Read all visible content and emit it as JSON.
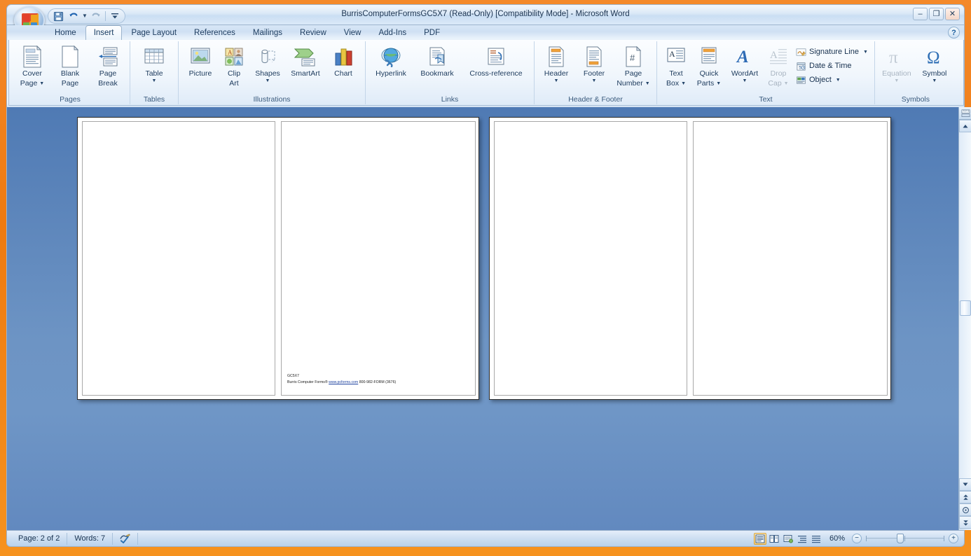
{
  "window": {
    "title": "BurrisComputerFormsGC5X7 (Read-Only) [Compatibility Mode] - Microsoft Word",
    "minimize_label": "–",
    "restore_label": "❐",
    "close_label": "✕",
    "help_label": "?",
    "accent_orange": "#f6921e",
    "workspace_blue": "#6289bf"
  },
  "quick_access": {
    "items": [
      {
        "name": "save",
        "label": "Save"
      },
      {
        "name": "undo",
        "label": "Undo"
      },
      {
        "name": "redo",
        "label": "Redo"
      }
    ],
    "customize_label": "Customize Quick Access Toolbar"
  },
  "ribbon": {
    "tabs": [
      {
        "label": "Home",
        "active": false
      },
      {
        "label": "Insert",
        "active": true
      },
      {
        "label": "Page Layout",
        "active": false
      },
      {
        "label": "References",
        "active": false
      },
      {
        "label": "Mailings",
        "active": false
      },
      {
        "label": "Review",
        "active": false
      },
      {
        "label": "View",
        "active": false
      },
      {
        "label": "Add-Ins",
        "active": false
      },
      {
        "label": "PDF",
        "active": false
      }
    ],
    "groups": [
      {
        "name": "pages",
        "label": "Pages",
        "buttons": [
          {
            "label_line1": "Cover",
            "label_line2": "Page",
            "dropdown": true,
            "disabled": false
          },
          {
            "label_line1": "Blank",
            "label_line2": "Page",
            "dropdown": false,
            "disabled": false
          },
          {
            "label_line1": "Page",
            "label_line2": "Break",
            "dropdown": false,
            "disabled": false
          }
        ]
      },
      {
        "name": "tables",
        "label": "Tables",
        "buttons": [
          {
            "label_line1": "Table",
            "label_line2": "",
            "dropdown": true,
            "disabled": false
          }
        ]
      },
      {
        "name": "illustrations",
        "label": "Illustrations",
        "buttons": [
          {
            "label_line1": "Picture",
            "label_line2": "",
            "dropdown": false,
            "disabled": false
          },
          {
            "label_line1": "Clip",
            "label_line2": "Art",
            "dropdown": false,
            "disabled": false
          },
          {
            "label_line1": "Shapes",
            "label_line2": "",
            "dropdown": true,
            "disabled": false
          },
          {
            "label_line1": "SmartArt",
            "label_line2": "",
            "dropdown": false,
            "disabled": false
          },
          {
            "label_line1": "Chart",
            "label_line2": "",
            "dropdown": false,
            "disabled": false
          }
        ]
      },
      {
        "name": "links",
        "label": "Links",
        "buttons": [
          {
            "label_line1": "Hyperlink",
            "label_line2": "",
            "dropdown": false,
            "disabled": false
          },
          {
            "label_line1": "Bookmark",
            "label_line2": "",
            "dropdown": false,
            "disabled": false
          },
          {
            "label_line1": "Cross-reference",
            "label_line2": "",
            "dropdown": false,
            "disabled": false
          }
        ]
      },
      {
        "name": "header-footer",
        "label": "Header & Footer",
        "buttons": [
          {
            "label_line1": "Header",
            "label_line2": "",
            "dropdown": true,
            "disabled": false
          },
          {
            "label_line1": "Footer",
            "label_line2": "",
            "dropdown": true,
            "disabled": false
          },
          {
            "label_line1": "Page",
            "label_line2": "Number",
            "dropdown": true,
            "disabled": false
          }
        ]
      },
      {
        "name": "text",
        "label": "Text",
        "buttons": [
          {
            "label_line1": "Text",
            "label_line2": "Box",
            "dropdown": true,
            "disabled": false
          },
          {
            "label_line1": "Quick",
            "label_line2": "Parts",
            "dropdown": true,
            "disabled": false
          },
          {
            "label_line1": "WordArt",
            "label_line2": "",
            "dropdown": true,
            "disabled": false
          },
          {
            "label_line1": "Drop",
            "label_line2": "Cap",
            "dropdown": true,
            "disabled": true
          }
        ],
        "small_buttons": [
          {
            "label": "Signature Line",
            "dropdown": true
          },
          {
            "label": "Date & Time",
            "dropdown": false
          },
          {
            "label": "Object",
            "dropdown": true
          }
        ]
      },
      {
        "name": "symbols",
        "label": "Symbols",
        "buttons": [
          {
            "label_line1": "Equation",
            "label_line2": "",
            "dropdown": true,
            "disabled": true
          },
          {
            "label_line1": "Symbol",
            "label_line2": "",
            "dropdown": true,
            "disabled": false
          }
        ]
      }
    ]
  },
  "document": {
    "spreads": [
      {
        "name": "spread-1",
        "pages": [
          {
            "name": "page-1",
            "text_lines": []
          },
          {
            "name": "page-2",
            "text_lines": [
              {
                "text": "GC5X7",
                "link": ""
              },
              {
                "prefix": "Burris Computer Forms® ",
                "link": "www.pcforms.com",
                "suffix": " 800-982-FORM (3676)"
              }
            ]
          }
        ]
      },
      {
        "name": "spread-2",
        "pages": [
          {
            "name": "page-3",
            "text_lines": []
          },
          {
            "name": "page-4",
            "text_lines": []
          }
        ]
      }
    ]
  },
  "status_bar": {
    "page_indicator": "Page: 2 of 2",
    "word_count": "Words: 7",
    "proofing_label": "Proofing errors",
    "zoom_level": "60%",
    "zoom_out_label": "−",
    "zoom_in_label": "+",
    "view_buttons": [
      {
        "name": "print-layout",
        "label": "Print Layout",
        "active": true
      },
      {
        "name": "full-screen-reading",
        "label": "Full Screen Reading",
        "active": false
      },
      {
        "name": "web-layout",
        "label": "Web Layout",
        "active": false
      },
      {
        "name": "outline",
        "label": "Outline",
        "active": false
      },
      {
        "name": "draft",
        "label": "Draft",
        "active": false
      }
    ]
  },
  "scrollbar": {
    "up_label": "▲",
    "down_label": "▼",
    "previous_page_label": "Previous Page",
    "browse_object_label": "Select Browse Object",
    "next_page_label": "Next Page",
    "ruler_toggle_label": "View Ruler"
  }
}
